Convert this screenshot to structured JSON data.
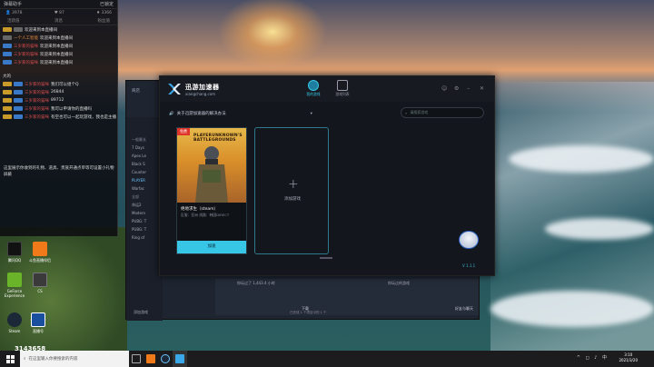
{
  "chat": {
    "title": "弹幕助手",
    "lock_label": "已锁定",
    "stats": {
      "viewers": "3978",
      "likes": "87",
      "gifts": "3366"
    },
    "columns": [
      "活跃值",
      "消息",
      "粉丝值"
    ],
    "messages": [
      {
        "badge": "",
        "user": "",
        "text": "欢迎来到本直播间"
      },
      {
        "badge": "",
        "user": "一个人工智能",
        "text": "欢迎来到本直播间"
      },
      {
        "badge": "",
        "user": "三岁家的猫咪",
        "text": "欢迎来到本直播间"
      },
      {
        "badge": "",
        "user": "三岁家的猫咪",
        "text": "欢迎来到本直播间"
      },
      {
        "badge": "",
        "user": "三岁家的猫咪",
        "text": "欢迎来到本直播间"
      }
    ],
    "messages2": [
      {
        "user": "三岁家的猫咪",
        "text": "我们可以组个Q"
      },
      {
        "user": "三岁家的猫咪",
        "text": "26844"
      },
      {
        "user": "三岁家的猫咪",
        "text": "89712"
      },
      {
        "user": "三岁家的猫咪",
        "text": "我可以申请你的直播吗"
      },
      {
        "user": "三岁家的猫咪",
        "text": "有空也可以一起玩游戏，我也是主播"
      }
    ],
    "side_labels": [
      "大的",
      "这里可以"
    ],
    "footer": "这里展示你收到的礼物、道具、贵族开通点单等可设置小礼物屏蔽"
  },
  "desktop": {
    "icons": [
      {
        "label": "腾讯QQ"
      },
      {
        "label": "斗鱼直播伴侣"
      },
      {
        "label": "GeForce Experience"
      },
      {
        "label": "CS"
      },
      {
        "label": "Steam"
      },
      {
        "label": "直播号"
      }
    ],
    "counter": "3143658"
  },
  "steam": {
    "side_items": [
      "7 Days",
      "Apex Le",
      "Black S",
      "Counter",
      "PLAYER",
      "Warfac",
      "命运2",
      "Modern",
      "PUBG: T",
      "PUBG: T",
      "Ring of"
    ],
    "store_label": "商店",
    "library_label": "游戏",
    "recent_label": "一般最长",
    "all_label": "全部",
    "bottom_left": "添加游戏",
    "bottom_status": "你玩过了 1,443.4 小时",
    "bottom_dl": "下载",
    "bottom_dl_sub": "已完成 1 个项目中的 1 个",
    "bottom_friend": "好友与聊天",
    "bottom_recent": "你玩过的游戏"
  },
  "accelerator": {
    "brand": "迅游加速器",
    "site": "xiangchang.com",
    "tabs": [
      {
        "label": "我的游戏"
      },
      {
        "label": "游戏列表"
      }
    ],
    "notice": "关于迅游加速器的解决办法",
    "search_placeholder": "请搜索游戏",
    "game": {
      "poster_title": "PLAYERUNKNOWN'S BATTLEGROUNDS",
      "badge": "免费",
      "name": "绝地求生（steam）",
      "meta": "区服：亚洲  线路：韩国DIRECT",
      "button": "加速"
    },
    "add_label": "添加游戏",
    "version": "V 1.1.1"
  },
  "taskbar": {
    "search_placeholder": "在这里输入你要搜索的内容",
    "time": "3:10",
    "date": "2021/3/20"
  },
  "colors": {
    "accent": "#37c6e6",
    "chat_bg": "#0c0e12",
    "app_bg": "#13161c"
  }
}
